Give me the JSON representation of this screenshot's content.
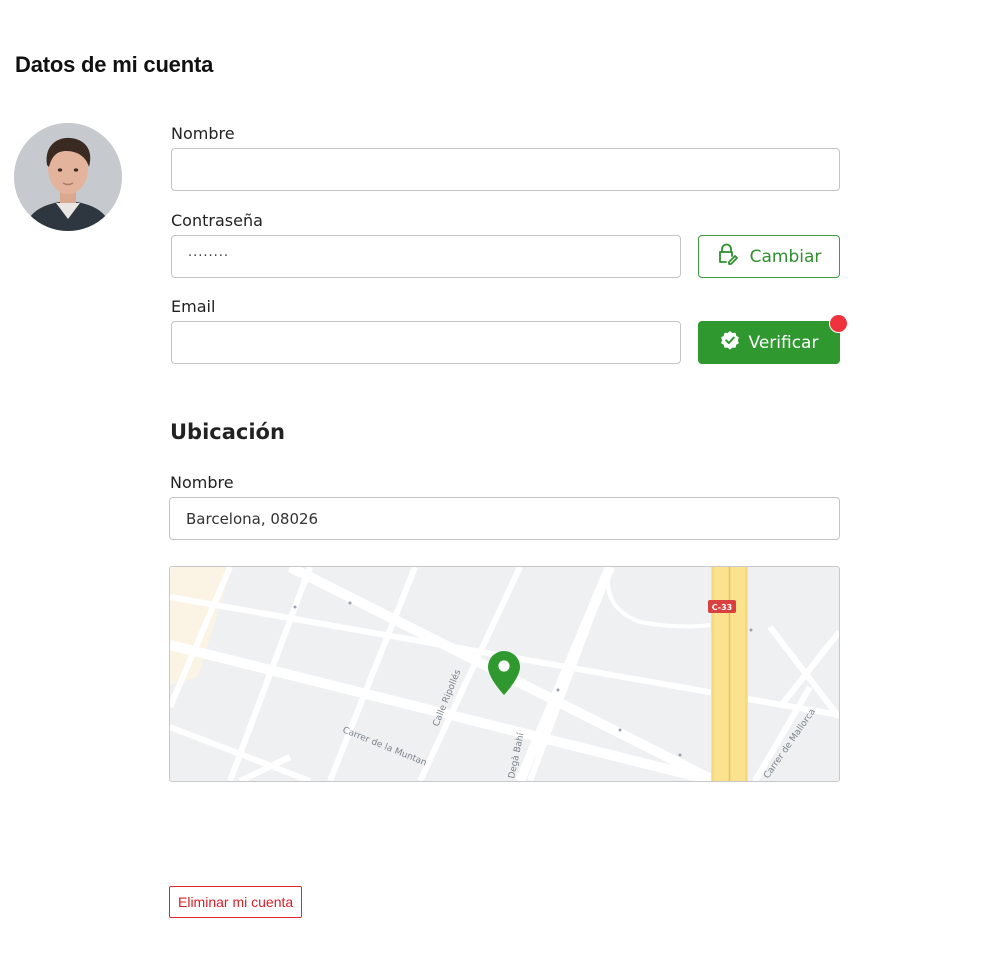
{
  "page": {
    "title": "Datos de mi cuenta"
  },
  "account": {
    "name_label": "Nombre",
    "name_value": "",
    "password_label": "Contraseña",
    "password_value": "········",
    "change_button": "Cambiar",
    "email_label": "Email",
    "email_value": "",
    "verify_button": "Verificar"
  },
  "location": {
    "section_title": "Ubicación",
    "name_label": "Nombre",
    "name_value": "Barcelona, 08026",
    "map": {
      "road_badge": "C-33",
      "street_labels": [
        "Calle Ripollés",
        "Carrer de la Muntan",
        "Degà Bahí",
        "Carrer de Mallorca"
      ]
    }
  },
  "delete_account_button": "Eliminar mi cuenta",
  "colors": {
    "accent": "#2f982f",
    "danger": "#e0282f",
    "notification": "#f0323c"
  }
}
